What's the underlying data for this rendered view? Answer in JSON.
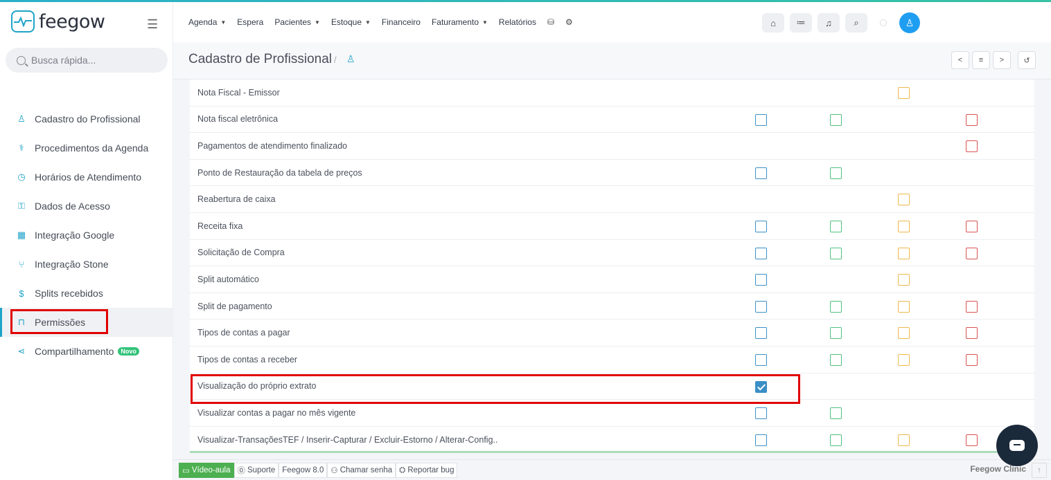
{
  "brand": {
    "name": "feegow"
  },
  "search": {
    "placeholder": "Busca rápida..."
  },
  "topnav": {
    "items": [
      {
        "label": "Agenda",
        "caret": true
      },
      {
        "label": "Espera",
        "caret": false
      },
      {
        "label": "Pacientes",
        "caret": true
      },
      {
        "label": "Estoque",
        "caret": true
      },
      {
        "label": "Financeiro",
        "caret": false
      },
      {
        "label": "Faturamento",
        "caret": true
      },
      {
        "label": "Relatórios",
        "caret": false
      }
    ]
  },
  "page": {
    "title": "Cadastro de Profissional",
    "separator": "/"
  },
  "sidebar": {
    "items": [
      {
        "label": "Cadastro do Profissional",
        "icon": "user-icon",
        "glyph": "♙"
      },
      {
        "label": "Procedimentos da Agenda",
        "icon": "stethoscope-icon",
        "glyph": "⚕"
      },
      {
        "label": "Horários de Atendimento",
        "icon": "clock-icon",
        "glyph": "◷"
      },
      {
        "label": "Dados de Acesso",
        "icon": "key-icon",
        "glyph": "⚿"
      },
      {
        "label": "Integração Google",
        "icon": "calendar-icon",
        "glyph": "▦"
      },
      {
        "label": "Integração Stone",
        "icon": "branch-icon",
        "glyph": "⑂"
      },
      {
        "label": "Splits recebidos",
        "icon": "dollar-icon",
        "glyph": "$"
      },
      {
        "label": "Permissões",
        "icon": "lock-icon",
        "glyph": "⊓"
      },
      {
        "label": "Compartilhamento",
        "icon": "share-icon",
        "glyph": "⋖",
        "badge": "Novo"
      }
    ],
    "active_index": 7
  },
  "permissions": {
    "rows": [
      {
        "label": "Nota Fiscal - Emissor",
        "boxes": [
          false,
          false,
          true,
          false
        ],
        "checked": []
      },
      {
        "label": "Nota fiscal eletrônica",
        "boxes": [
          true,
          true,
          false,
          true
        ],
        "checked": []
      },
      {
        "label": "Pagamentos de atendimento finalizado",
        "boxes": [
          false,
          false,
          false,
          true
        ],
        "checked": []
      },
      {
        "label": "Ponto de Restauração da tabela de preços",
        "boxes": [
          true,
          true,
          false,
          false
        ],
        "checked": []
      },
      {
        "label": "Reabertura de caixa",
        "boxes": [
          false,
          false,
          true,
          false
        ],
        "checked": []
      },
      {
        "label": "Receita fixa",
        "boxes": [
          true,
          true,
          true,
          true
        ],
        "checked": []
      },
      {
        "label": "Solicitação de Compra",
        "boxes": [
          true,
          true,
          true,
          true
        ],
        "checked": []
      },
      {
        "label": "Split automático",
        "boxes": [
          true,
          false,
          true,
          false
        ],
        "checked": []
      },
      {
        "label": "Split de pagamento",
        "boxes": [
          true,
          true,
          true,
          true
        ],
        "checked": []
      },
      {
        "label": "Tipos de contas a pagar",
        "boxes": [
          true,
          true,
          true,
          true
        ],
        "checked": []
      },
      {
        "label": "Tipos de contas a receber",
        "boxes": [
          true,
          true,
          true,
          true
        ],
        "checked": []
      },
      {
        "label": "Visualização do próprio extrato",
        "boxes": [
          true,
          false,
          false,
          false
        ],
        "checked": [
          0
        ],
        "highlight": true
      },
      {
        "label": "Visualizar contas a pagar no mês vigente",
        "boxes": [
          true,
          true,
          false,
          false
        ],
        "checked": []
      },
      {
        "label": "Visualizar-TransaçõesTEF / Inserir-Capturar / Excluir-Estorno / Alterar-Config..",
        "boxes": [
          true,
          true,
          true,
          true
        ],
        "checked": []
      }
    ]
  },
  "footer": {
    "video": "Vídeo-aula",
    "support": "Suporte",
    "version": "Feegow 8.0",
    "call": "Chamar senha",
    "bug": "Reportar bug",
    "brand": "Feegow Clinic"
  }
}
